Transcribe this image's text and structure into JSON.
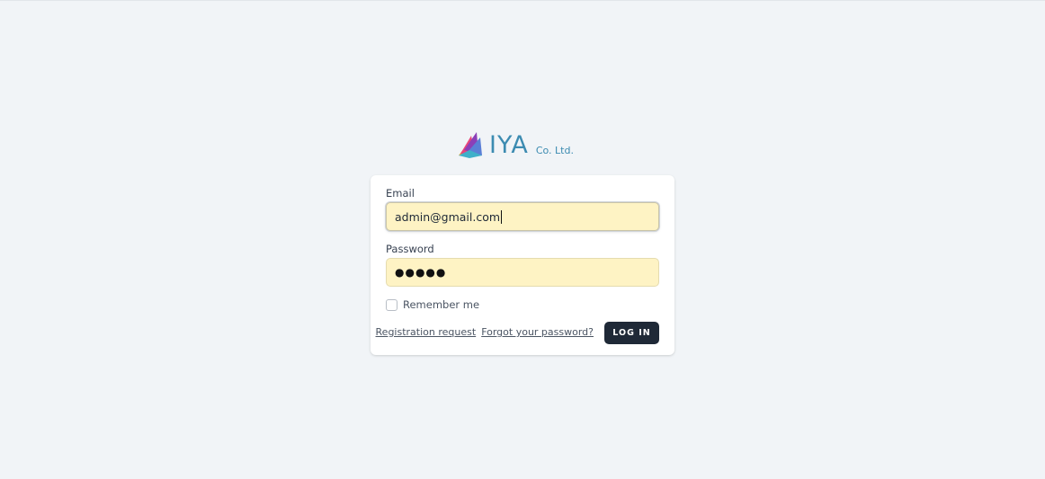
{
  "logo": {
    "name": "IYA",
    "suffix": "Co. Ltd."
  },
  "form": {
    "email_label": "Email",
    "email_value": "admin@gmail.com",
    "password_label": "Password",
    "password_mask": "●●●●●",
    "remember_label": "Remember me",
    "registration_link": "Registration request",
    "forgot_link": "Forgot your password?",
    "login_button": "LOG IN"
  },
  "colors": {
    "background": "#f1f4f7",
    "input_autofill": "#fef3c4",
    "button": "#1f2937",
    "brand": "#3c8bb1"
  }
}
